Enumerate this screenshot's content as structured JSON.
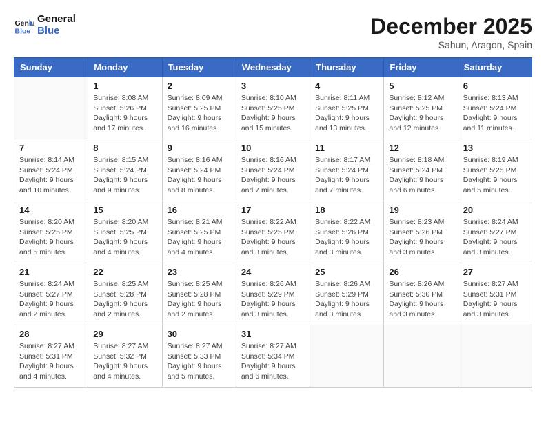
{
  "header": {
    "logo_line1": "General",
    "logo_line2": "Blue",
    "month": "December 2025",
    "location": "Sahun, Aragon, Spain"
  },
  "weekdays": [
    "Sunday",
    "Monday",
    "Tuesday",
    "Wednesday",
    "Thursday",
    "Friday",
    "Saturday"
  ],
  "weeks": [
    [
      {
        "day": "",
        "sunrise": "",
        "sunset": "",
        "daylight": ""
      },
      {
        "day": "1",
        "sunrise": "Sunrise: 8:08 AM",
        "sunset": "Sunset: 5:26 PM",
        "daylight": "Daylight: 9 hours and 17 minutes."
      },
      {
        "day": "2",
        "sunrise": "Sunrise: 8:09 AM",
        "sunset": "Sunset: 5:25 PM",
        "daylight": "Daylight: 9 hours and 16 minutes."
      },
      {
        "day": "3",
        "sunrise": "Sunrise: 8:10 AM",
        "sunset": "Sunset: 5:25 PM",
        "daylight": "Daylight: 9 hours and 15 minutes."
      },
      {
        "day": "4",
        "sunrise": "Sunrise: 8:11 AM",
        "sunset": "Sunset: 5:25 PM",
        "daylight": "Daylight: 9 hours and 13 minutes."
      },
      {
        "day": "5",
        "sunrise": "Sunrise: 8:12 AM",
        "sunset": "Sunset: 5:25 PM",
        "daylight": "Daylight: 9 hours and 12 minutes."
      },
      {
        "day": "6",
        "sunrise": "Sunrise: 8:13 AM",
        "sunset": "Sunset: 5:24 PM",
        "daylight": "Daylight: 9 hours and 11 minutes."
      }
    ],
    [
      {
        "day": "7",
        "sunrise": "Sunrise: 8:14 AM",
        "sunset": "Sunset: 5:24 PM",
        "daylight": "Daylight: 9 hours and 10 minutes."
      },
      {
        "day": "8",
        "sunrise": "Sunrise: 8:15 AM",
        "sunset": "Sunset: 5:24 PM",
        "daylight": "Daylight: 9 hours and 9 minutes."
      },
      {
        "day": "9",
        "sunrise": "Sunrise: 8:16 AM",
        "sunset": "Sunset: 5:24 PM",
        "daylight": "Daylight: 9 hours and 8 minutes."
      },
      {
        "day": "10",
        "sunrise": "Sunrise: 8:16 AM",
        "sunset": "Sunset: 5:24 PM",
        "daylight": "Daylight: 9 hours and 7 minutes."
      },
      {
        "day": "11",
        "sunrise": "Sunrise: 8:17 AM",
        "sunset": "Sunset: 5:24 PM",
        "daylight": "Daylight: 9 hours and 7 minutes."
      },
      {
        "day": "12",
        "sunrise": "Sunrise: 8:18 AM",
        "sunset": "Sunset: 5:24 PM",
        "daylight": "Daylight: 9 hours and 6 minutes."
      },
      {
        "day": "13",
        "sunrise": "Sunrise: 8:19 AM",
        "sunset": "Sunset: 5:25 PM",
        "daylight": "Daylight: 9 hours and 5 minutes."
      }
    ],
    [
      {
        "day": "14",
        "sunrise": "Sunrise: 8:20 AM",
        "sunset": "Sunset: 5:25 PM",
        "daylight": "Daylight: 9 hours and 5 minutes."
      },
      {
        "day": "15",
        "sunrise": "Sunrise: 8:20 AM",
        "sunset": "Sunset: 5:25 PM",
        "daylight": "Daylight: 9 hours and 4 minutes."
      },
      {
        "day": "16",
        "sunrise": "Sunrise: 8:21 AM",
        "sunset": "Sunset: 5:25 PM",
        "daylight": "Daylight: 9 hours and 4 minutes."
      },
      {
        "day": "17",
        "sunrise": "Sunrise: 8:22 AM",
        "sunset": "Sunset: 5:25 PM",
        "daylight": "Daylight: 9 hours and 3 minutes."
      },
      {
        "day": "18",
        "sunrise": "Sunrise: 8:22 AM",
        "sunset": "Sunset: 5:26 PM",
        "daylight": "Daylight: 9 hours and 3 minutes."
      },
      {
        "day": "19",
        "sunrise": "Sunrise: 8:23 AM",
        "sunset": "Sunset: 5:26 PM",
        "daylight": "Daylight: 9 hours and 3 minutes."
      },
      {
        "day": "20",
        "sunrise": "Sunrise: 8:24 AM",
        "sunset": "Sunset: 5:27 PM",
        "daylight": "Daylight: 9 hours and 3 minutes."
      }
    ],
    [
      {
        "day": "21",
        "sunrise": "Sunrise: 8:24 AM",
        "sunset": "Sunset: 5:27 PM",
        "daylight": "Daylight: 9 hours and 2 minutes."
      },
      {
        "day": "22",
        "sunrise": "Sunrise: 8:25 AM",
        "sunset": "Sunset: 5:28 PM",
        "daylight": "Daylight: 9 hours and 2 minutes."
      },
      {
        "day": "23",
        "sunrise": "Sunrise: 8:25 AM",
        "sunset": "Sunset: 5:28 PM",
        "daylight": "Daylight: 9 hours and 2 minutes."
      },
      {
        "day": "24",
        "sunrise": "Sunrise: 8:26 AM",
        "sunset": "Sunset: 5:29 PM",
        "daylight": "Daylight: 9 hours and 3 minutes."
      },
      {
        "day": "25",
        "sunrise": "Sunrise: 8:26 AM",
        "sunset": "Sunset: 5:29 PM",
        "daylight": "Daylight: 9 hours and 3 minutes."
      },
      {
        "day": "26",
        "sunrise": "Sunrise: 8:26 AM",
        "sunset": "Sunset: 5:30 PM",
        "daylight": "Daylight: 9 hours and 3 minutes."
      },
      {
        "day": "27",
        "sunrise": "Sunrise: 8:27 AM",
        "sunset": "Sunset: 5:31 PM",
        "daylight": "Daylight: 9 hours and 3 minutes."
      }
    ],
    [
      {
        "day": "28",
        "sunrise": "Sunrise: 8:27 AM",
        "sunset": "Sunset: 5:31 PM",
        "daylight": "Daylight: 9 hours and 4 minutes."
      },
      {
        "day": "29",
        "sunrise": "Sunrise: 8:27 AM",
        "sunset": "Sunset: 5:32 PM",
        "daylight": "Daylight: 9 hours and 4 minutes."
      },
      {
        "day": "30",
        "sunrise": "Sunrise: 8:27 AM",
        "sunset": "Sunset: 5:33 PM",
        "daylight": "Daylight: 9 hours and 5 minutes."
      },
      {
        "day": "31",
        "sunrise": "Sunrise: 8:27 AM",
        "sunset": "Sunset: 5:34 PM",
        "daylight": "Daylight: 9 hours and 6 minutes."
      },
      {
        "day": "",
        "sunrise": "",
        "sunset": "",
        "daylight": ""
      },
      {
        "day": "",
        "sunrise": "",
        "sunset": "",
        "daylight": ""
      },
      {
        "day": "",
        "sunrise": "",
        "sunset": "",
        "daylight": ""
      }
    ]
  ]
}
